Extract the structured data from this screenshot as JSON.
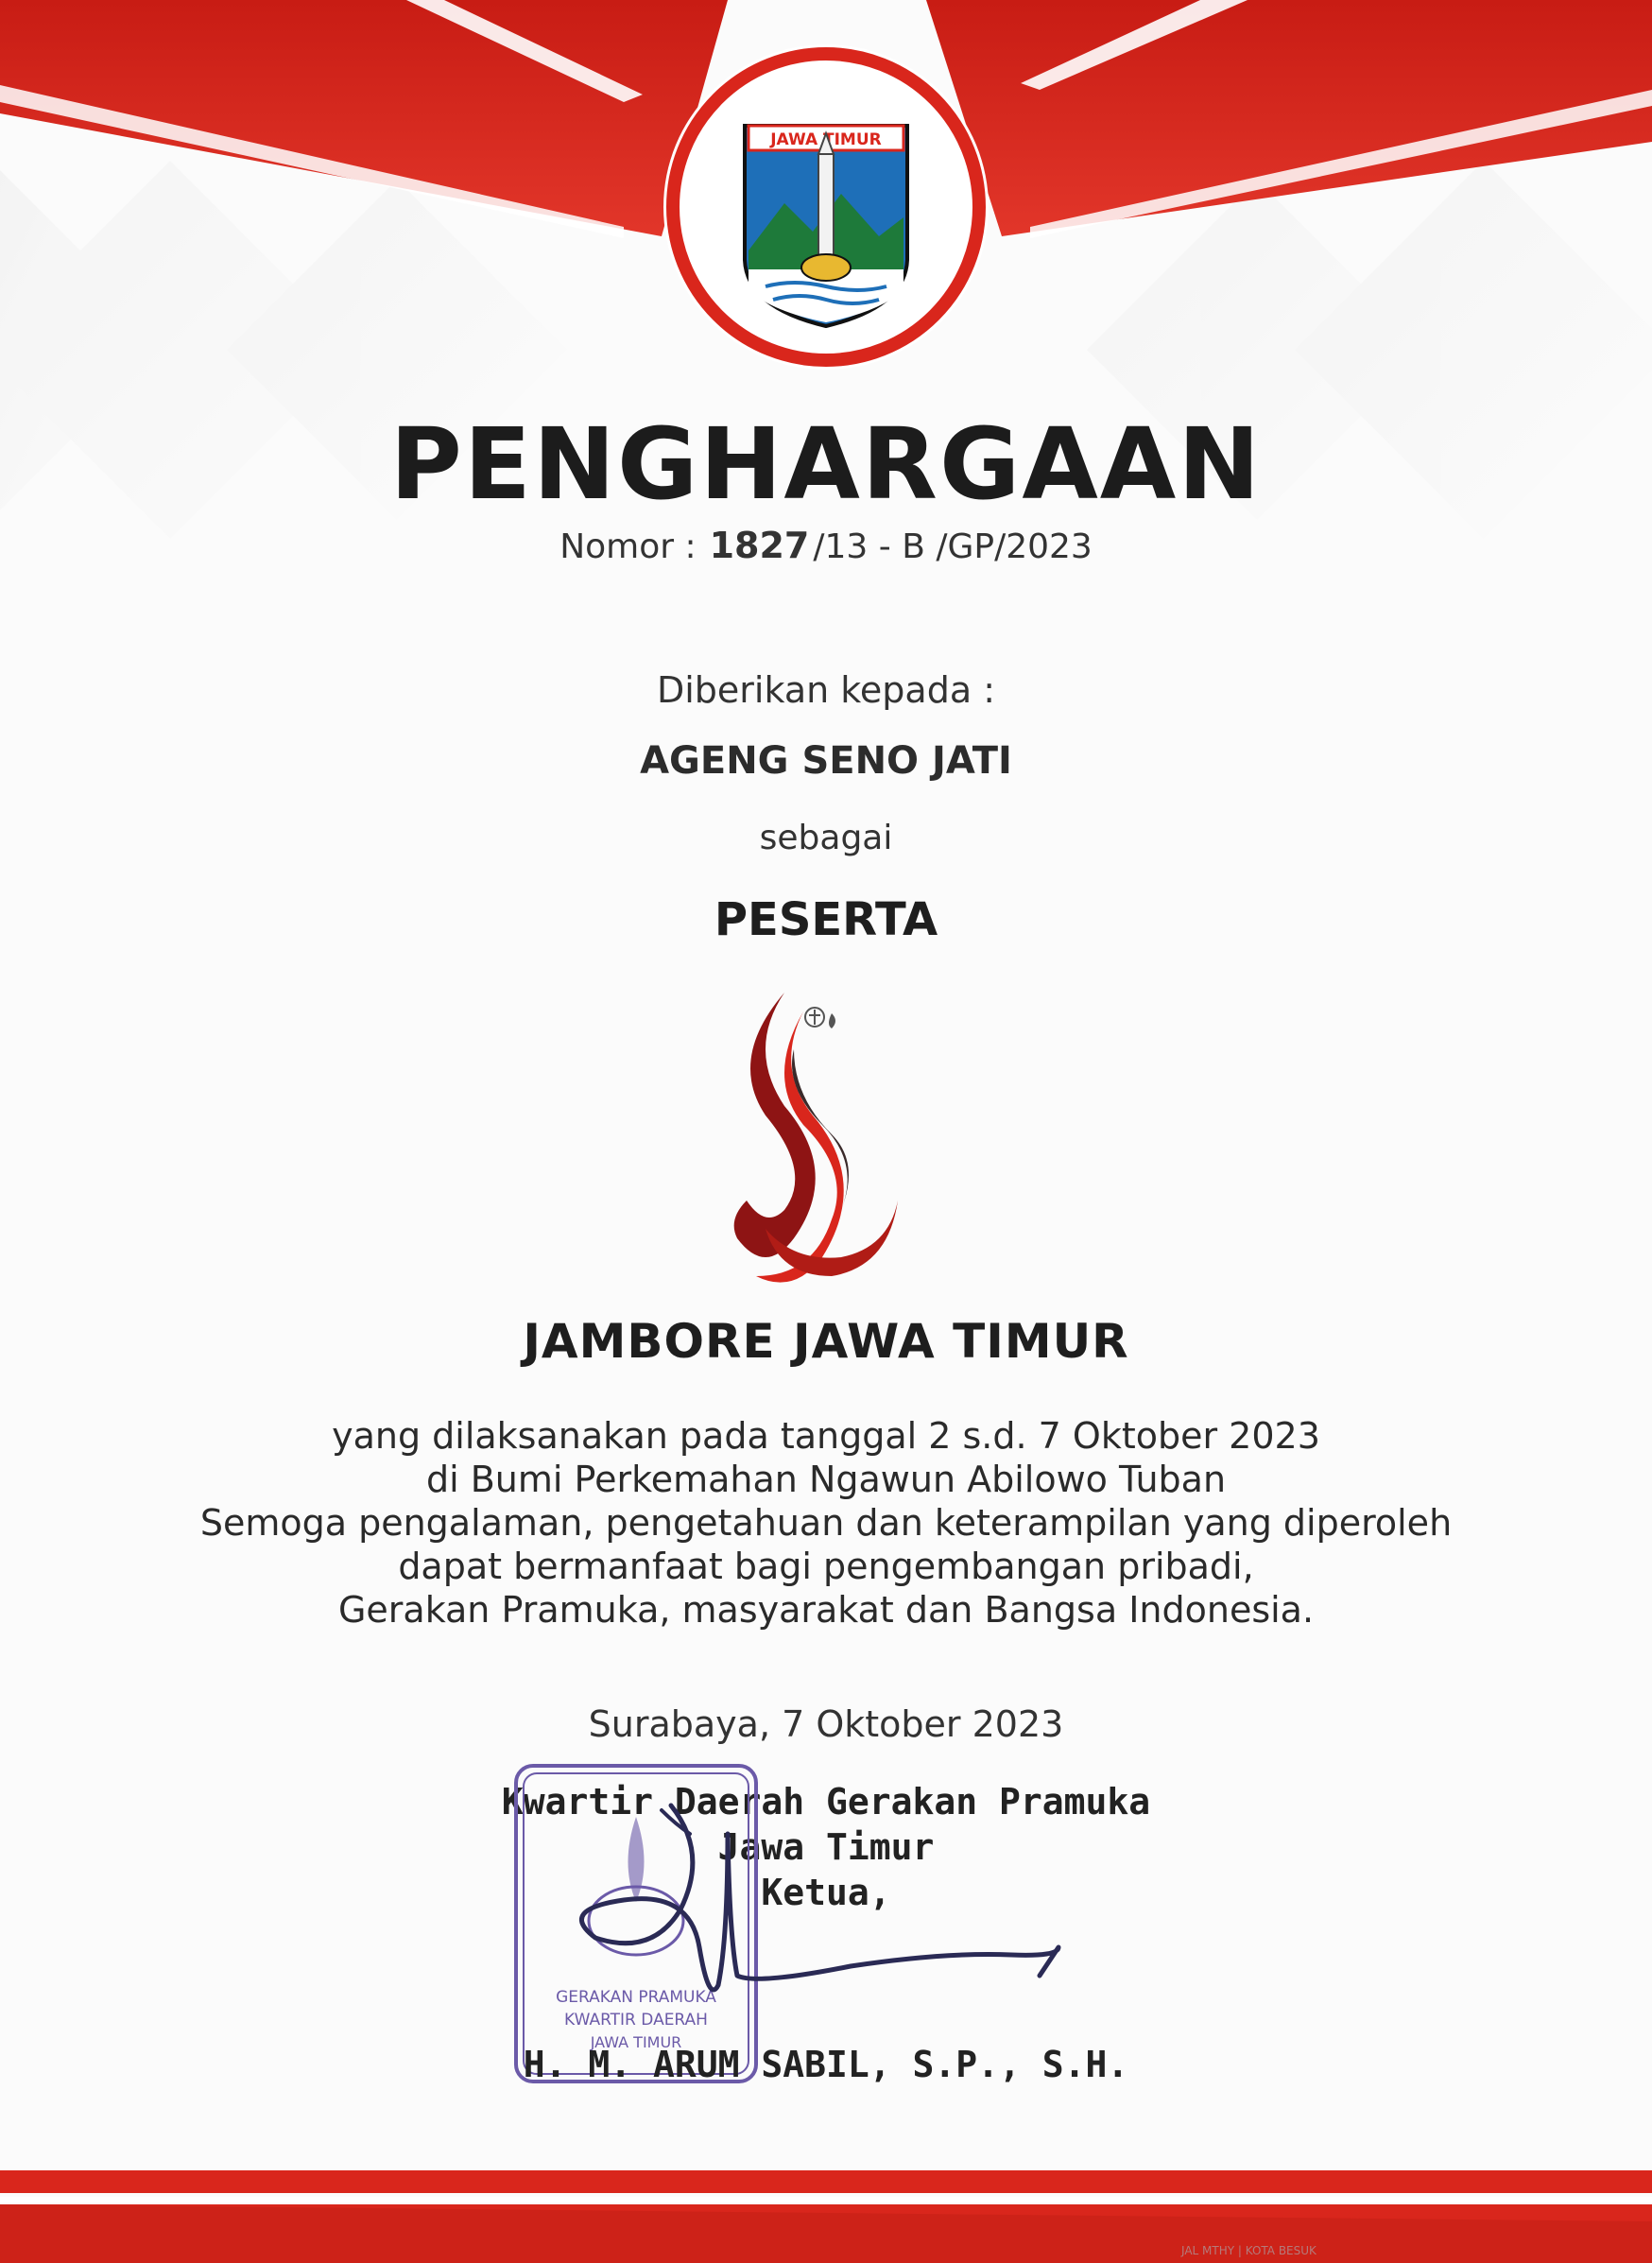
{
  "certificate": {
    "emblem_text": "JAWA TIMUR",
    "title": "PENGHARGAAN",
    "nomor_label": "Nomor :",
    "nomor_number": "1827",
    "nomor_suffix": "/13 - B /GP/2023",
    "given_to_label": "Diberikan kepada :",
    "recipient_name": "AGENG SENO JATI",
    "as_label": "sebagai",
    "role": "PESERTA",
    "event_name": "JAMBORE JAWA TIMUR",
    "body_lines": [
      "yang dilaksanakan pada tanggal 2 s.d. 7 Oktober 2023",
      "di Bumi Perkemahan Ngawun Abilowo Tuban",
      "Semoga pengalaman, pengetahuan dan keterampilan yang diperoleh",
      "dapat bermanfaat bagi pengembangan pribadi,",
      "Gerakan Pramuka, masyarakat dan Bangsa Indonesia."
    ],
    "place_date": "Surabaya, 7 Oktober 2023",
    "org_lines": [
      "Kwartir Daerah Gerakan Pramuka",
      "Jawa Timur",
      "Ketua,"
    ],
    "signer_name": "H. M. ARUM SABIL, S.P., S.H.",
    "stamp_lines": [
      "GERAKAN PRAMUKA",
      "KWARTIR DAERAH",
      "JAWA TIMUR"
    ],
    "footer_note": "JAL MTHY | KOTA BESUK"
  },
  "colors": {
    "primary_red": "#d9261c",
    "dark_red": "#8e1414",
    "text_dark": "#1e1e1e",
    "stamp_purple": "#6b5aa8",
    "signature_ink": "#2a2a55"
  },
  "icons": {
    "emblem": "jawa-timur-coat-of-arms-icon",
    "event_logo": "jambore-flame-logo-icon",
    "scout_emblems": "tunas-kelapa-icon"
  }
}
